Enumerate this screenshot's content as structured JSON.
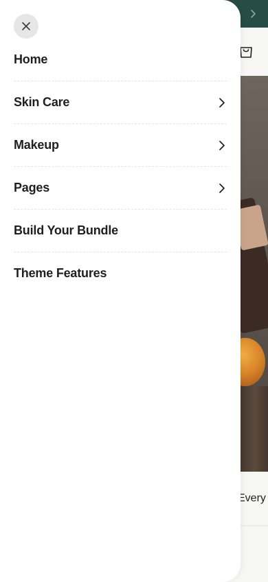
{
  "background": {
    "caption_text": "Every S"
  },
  "menu": {
    "items": [
      {
        "label": "Home",
        "has_submenu": false
      },
      {
        "label": "Skin Care",
        "has_submenu": true
      },
      {
        "label": "Makeup",
        "has_submenu": true
      },
      {
        "label": "Pages",
        "has_submenu": true
      },
      {
        "label": "Build Your Bundle",
        "has_submenu": false
      },
      {
        "label": "Theme Features",
        "has_submenu": false
      }
    ]
  },
  "icons": {
    "close": "close-icon",
    "chevron": "chevron-right-icon",
    "cart": "shopping-bag-icon"
  },
  "colors": {
    "announce_bar": "#274c45",
    "drawer": "#ffffff",
    "close_button_bg": "#e6e6e6",
    "text": "#1f1f1f"
  }
}
